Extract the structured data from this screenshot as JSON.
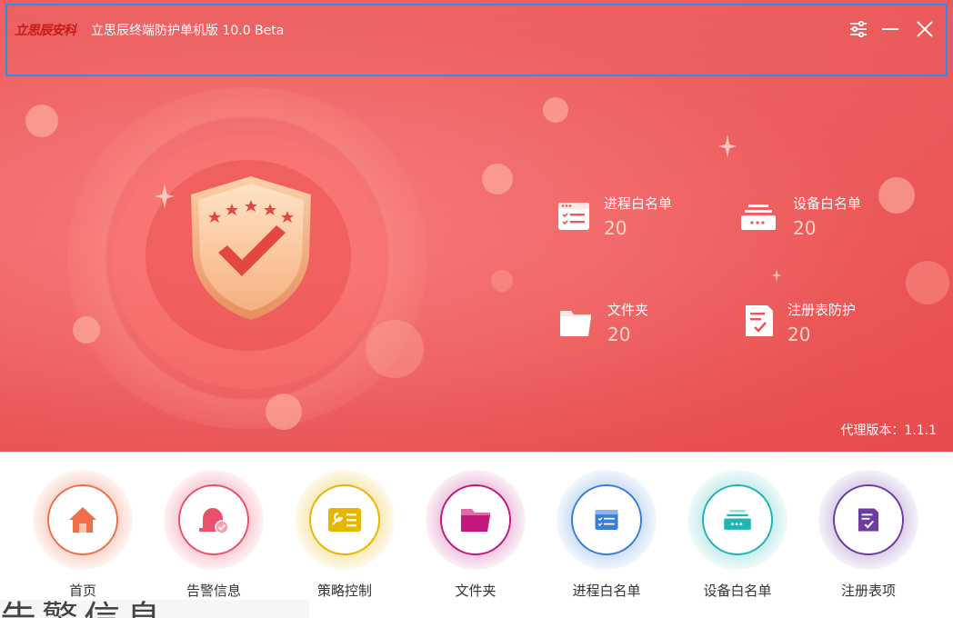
{
  "titlebar": {
    "brand": "立思辰安科",
    "title": "立思辰终端防护单机版 10.0 Beta"
  },
  "stats": [
    {
      "label": "进程白名单",
      "value": "20",
      "icon": "process-list-icon"
    },
    {
      "label": "设备白名单",
      "value": "20",
      "icon": "device-icon"
    },
    {
      "label": "文件夹",
      "value": "20",
      "icon": "folder-icon"
    },
    {
      "label": "注册表防护",
      "value": "20",
      "icon": "registry-icon"
    }
  ],
  "version": "代理版本：1.1.1",
  "nav": [
    {
      "label": "首页",
      "icon": "home-icon",
      "color": "#ef6f4a"
    },
    {
      "label": "告警信息",
      "icon": "alarm-icon",
      "color": "#e9506a"
    },
    {
      "label": "策略控制",
      "icon": "policy-icon",
      "color": "#e7b400"
    },
    {
      "label": "文件夹",
      "icon": "folder-icon",
      "color": "#c2187e"
    },
    {
      "label": "进程白名单",
      "icon": "process-list-icon",
      "color": "#3a7fd6"
    },
    {
      "label": "设备白名单",
      "icon": "device-icon",
      "color": "#1fb5b3"
    },
    {
      "label": "注册表项",
      "icon": "registry-icon",
      "color": "#6c3ca0"
    }
  ],
  "bottom_cut_text": "告警信息",
  "colors": {
    "accent": "#ec5656",
    "title_border": "#2d8cf0"
  }
}
